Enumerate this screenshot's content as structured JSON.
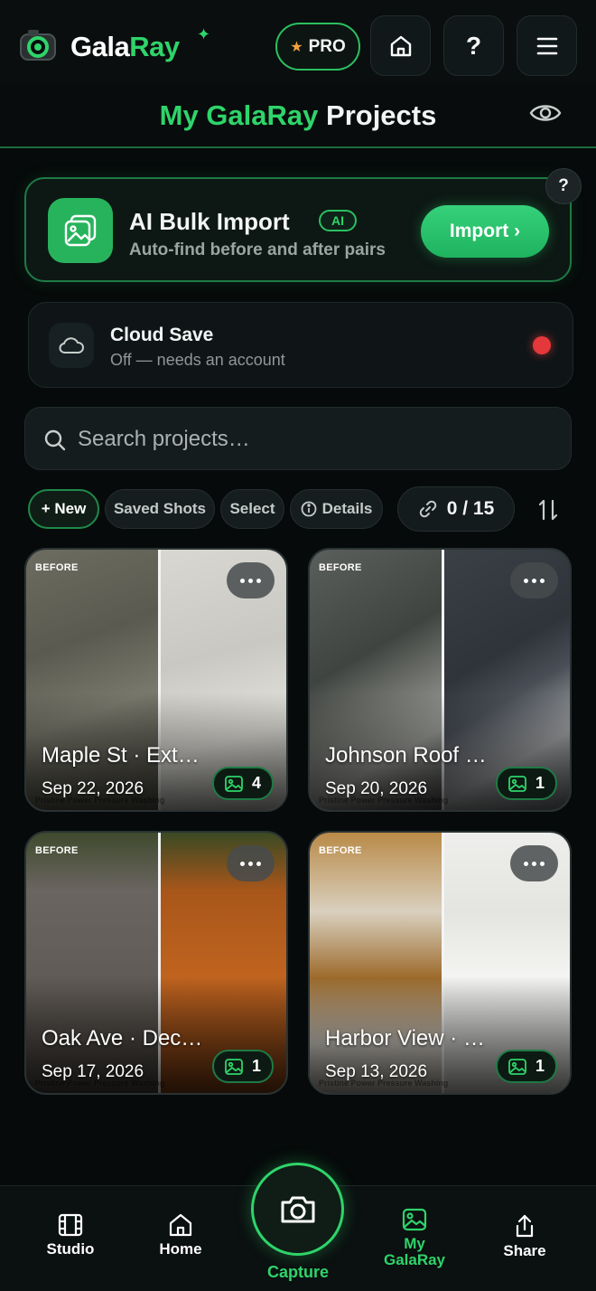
{
  "header": {
    "brand_part1": "Gala",
    "brand_part2": "Ray",
    "pro_label": "PRO",
    "help_label": "?"
  },
  "page": {
    "title_part1": "My GalaRay",
    "title_part2": "Projects"
  },
  "import_card": {
    "title": "AI Bulk Import",
    "badge": "AI",
    "subtitle": "Auto-find before and after pairs",
    "button_label": "Import ›",
    "help_label": "?"
  },
  "cloud_save": {
    "title": "Cloud Save",
    "status_text": "Off — needs an account",
    "status_color": "#e5383b"
  },
  "search": {
    "placeholder": "Search projects…",
    "value": ""
  },
  "toolbar": {
    "new_label": "+ New",
    "saved_label": "Saved Shots",
    "select_label": "Select",
    "details_label": "Details",
    "counter": "0 / 15"
  },
  "projects": [
    {
      "name": "Maple St · Ext…",
      "date": "Sep 22, 2026",
      "count": "4",
      "before_label": "BEFORE",
      "watermark": "Pristine Power Pressure Washing"
    },
    {
      "name": "Johnson Roof …",
      "date": "Sep 20, 2026",
      "count": "1",
      "before_label": "BEFORE",
      "watermark": "Pristine Power Pressure Washing"
    },
    {
      "name": "Oak Ave · Dec…",
      "date": "Sep 17, 2026",
      "count": "1",
      "before_label": "BEFORE",
      "watermark": "Pristine Power Pressure Washing"
    },
    {
      "name": "Harbor View · …",
      "date": "Sep 13, 2026",
      "count": "1",
      "before_label": "BEFORE",
      "watermark": "Pristine Power Pressure Washing"
    }
  ],
  "bottom_nav": {
    "studio": "Studio",
    "home": "Home",
    "capture": "Capture",
    "my_line1": "My",
    "my_line2": "GalaRay",
    "share": "Share"
  },
  "colors": {
    "accent": "#2fd46a",
    "background": "#060a0a",
    "pro_star": "#f2a23a"
  }
}
